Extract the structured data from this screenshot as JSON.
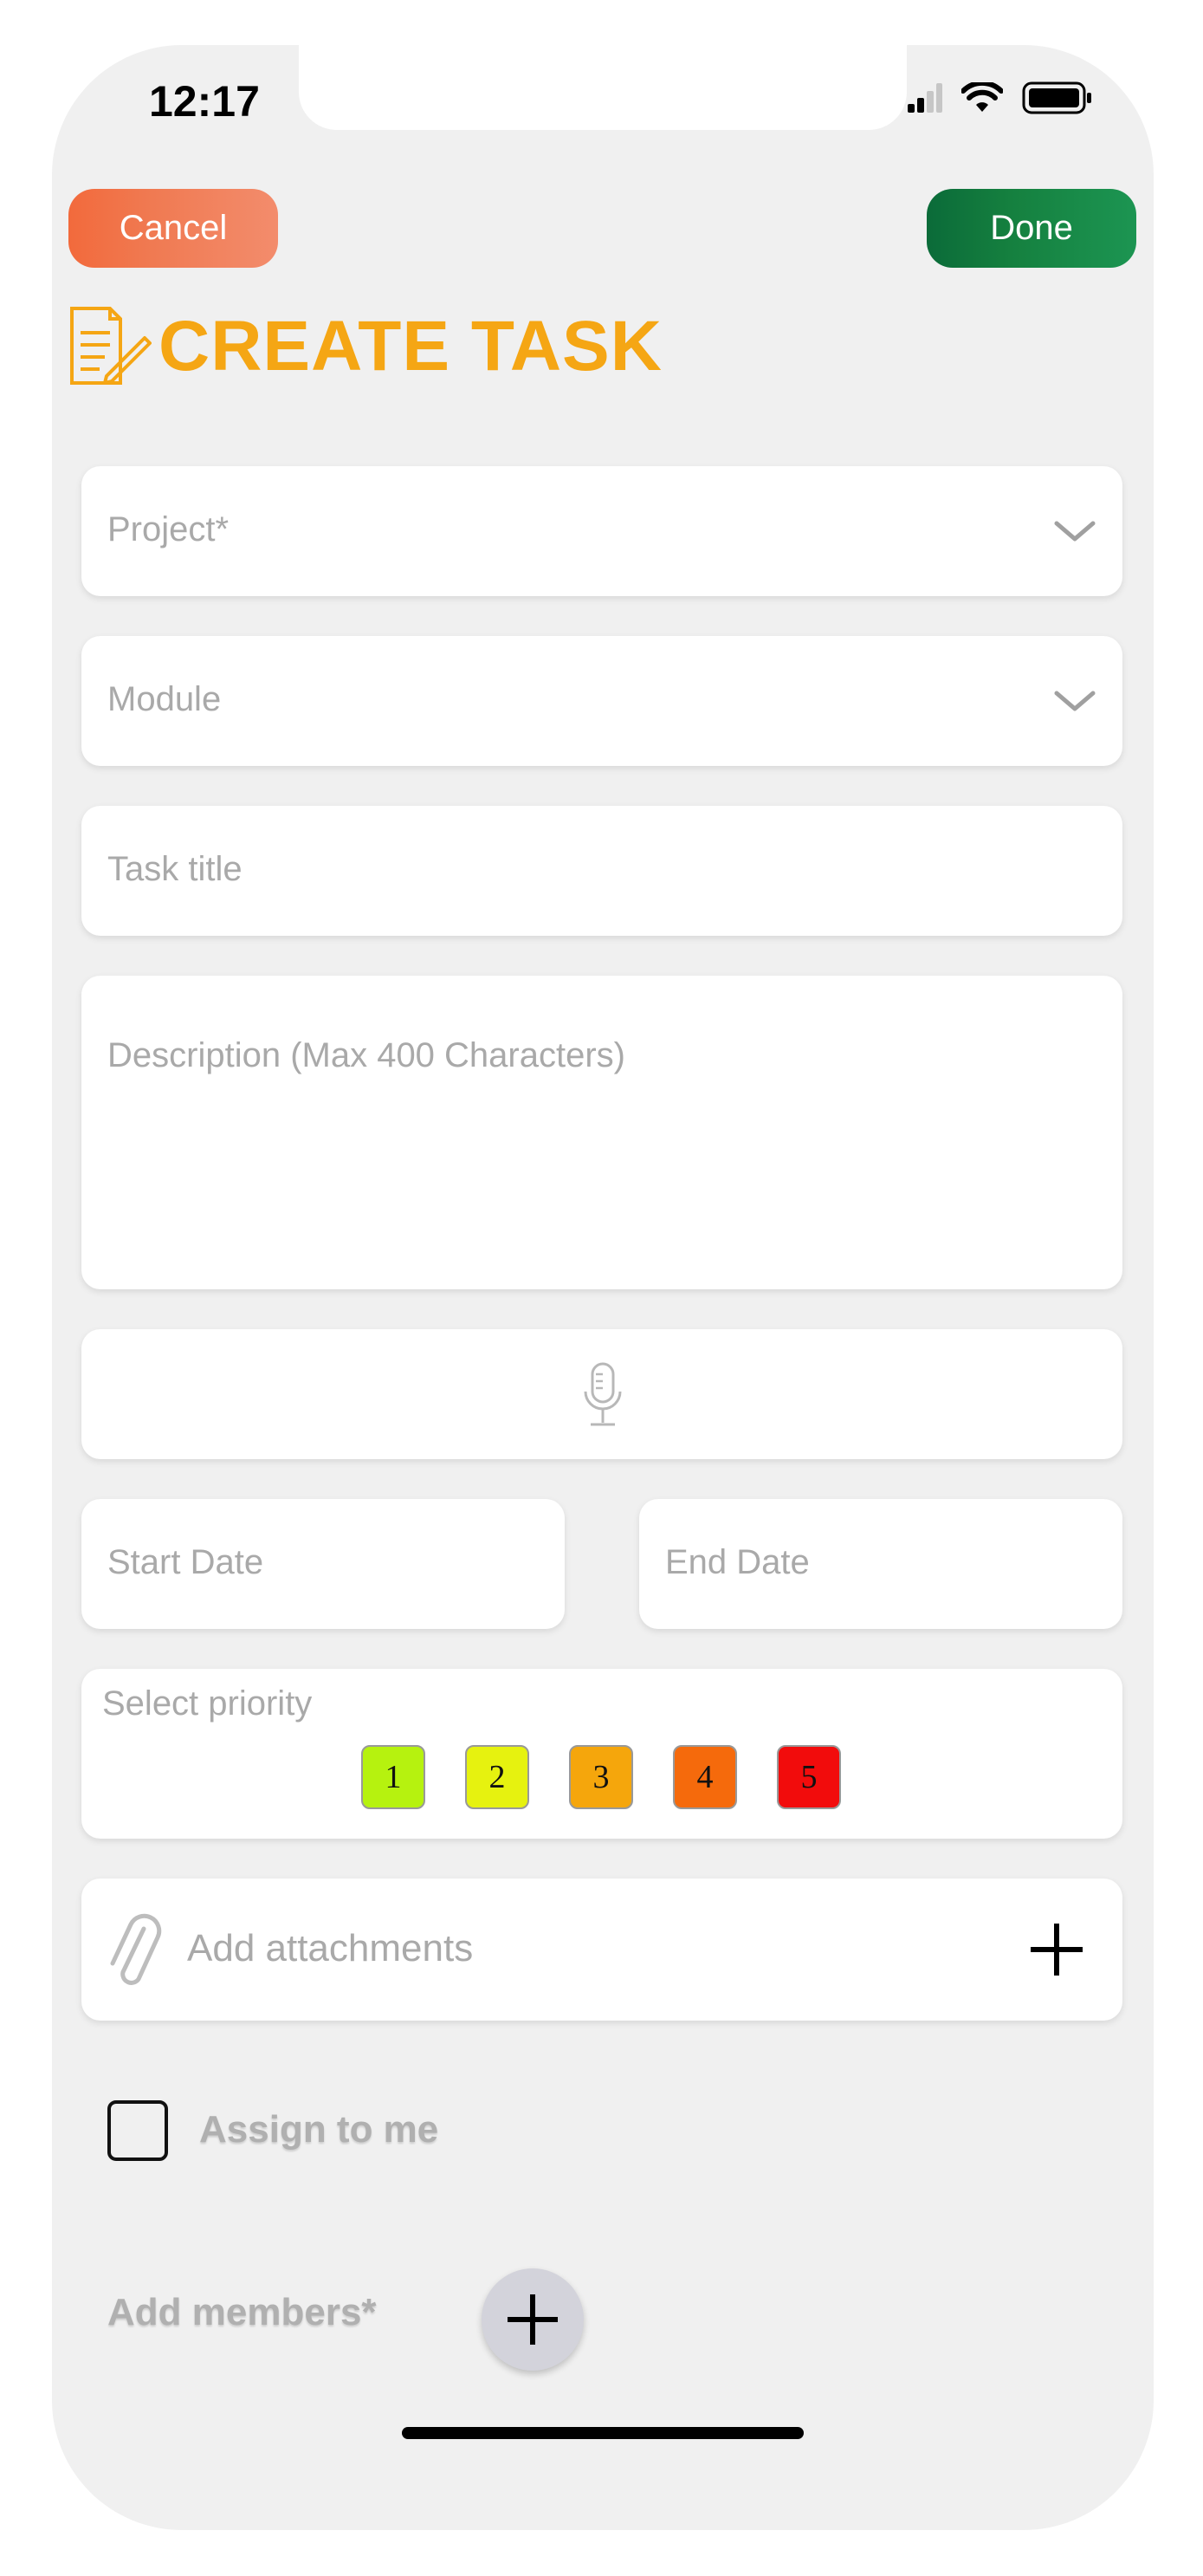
{
  "status_bar": {
    "time": "12:17"
  },
  "header": {
    "cancel_label": "Cancel",
    "done_label": "Done",
    "title": "CREATE TASK",
    "title_color": "#f5a614",
    "cancel_color": "#f26a3c",
    "done_color": "#15803f"
  },
  "form": {
    "project_placeholder": "Project*",
    "module_placeholder": "Module",
    "task_title_placeholder": "Task title",
    "description_placeholder": "Description (Max 400 Characters)",
    "voice_icon": "microphone-icon",
    "start_date_placeholder": "Start Date",
    "end_date_placeholder": "End Date",
    "priority_label": "Select priority",
    "priorities": [
      {
        "label": "1",
        "color": "#b6f20f"
      },
      {
        "label": "2",
        "color": "#e6f20f"
      },
      {
        "label": "3",
        "color": "#f5a60c"
      },
      {
        "label": "4",
        "color": "#f56a0c"
      },
      {
        "label": "5",
        "color": "#f20c0c"
      }
    ],
    "attachments_label": "Add attachments",
    "assign_label": "Assign to me",
    "add_members_label": "Add members*"
  }
}
